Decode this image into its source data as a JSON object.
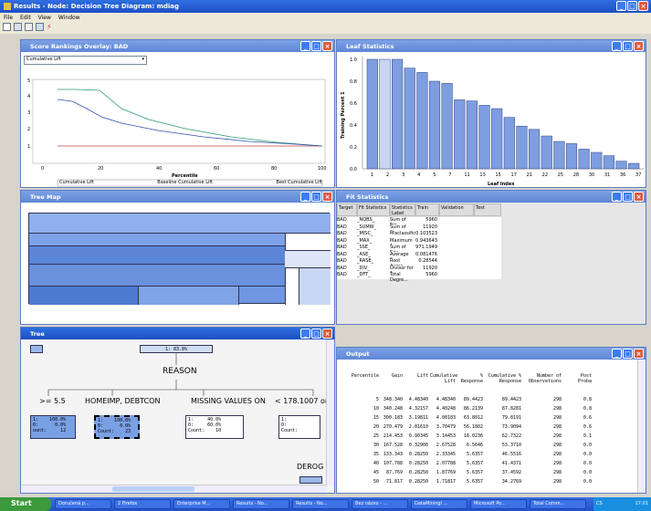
{
  "window": {
    "title": "Results - Node: Decision Tree Diagram: mdiag"
  },
  "menu": [
    "File",
    "Edit",
    "View",
    "Window"
  ],
  "score_panel": {
    "title": "Score Rankings Overlay: BAD",
    "dropdown": "Cumulative Lift",
    "xlabel": "Percentile",
    "legend": [
      "Cumulative Lift",
      "Baseline Cumulative Lift",
      "Best Cumulative Lift"
    ],
    "yticks": [
      "1",
      "2",
      "3",
      "4",
      "5"
    ],
    "xticks": [
      "0",
      "20",
      "40",
      "60",
      "80",
      "100"
    ]
  },
  "leaf_panel": {
    "title": "Leaf Statistics",
    "ylabel": "Training Percent 1",
    "xlabel": "Leaf Index",
    "yticks": [
      "0.0",
      "0.2",
      "0.4",
      "0.6",
      "0.8",
      "1.0"
    ],
    "xticks": [
      "1",
      "2",
      "3",
      "4",
      "5",
      "7",
      "11",
      "13",
      "15",
      "17",
      "21",
      "22",
      "25",
      "28",
      "30",
      "31",
      "36",
      "37"
    ]
  },
  "chart_data": {
    "type": "bar",
    "xlabel": "Leaf Index",
    "ylabel": "Training Percent 1",
    "ylim": [
      0,
      1
    ],
    "values": [
      1.0,
      1.0,
      1.0,
      0.92,
      0.88,
      0.8,
      0.78,
      0.63,
      0.62,
      0.58,
      0.55,
      0.47,
      0.39,
      0.36,
      0.3,
      0.25,
      0.23,
      0.18,
      0.15,
      0.12,
      0.07,
      0.05
    ]
  },
  "treemap_panel": {
    "title": "Tree Map"
  },
  "fit_panel": {
    "title": "Fit Statistics",
    "headers": [
      "Target",
      "Fit Statistics",
      "Statistics Label",
      "Train",
      "Validation",
      "Test"
    ],
    "rows": [
      [
        "BAD",
        "_NOBS_",
        "Sum of Fre...",
        "5960",
        "",
        ""
      ],
      [
        "BAD",
        "_SUMW_",
        "Sum of Cas...",
        "11920",
        "",
        ""
      ],
      [
        "BAD",
        "_MISC_",
        "Misclassific...",
        "0.103523",
        "",
        ""
      ],
      [
        "BAD",
        "_MAX_",
        "Maximum A...",
        "0.943643",
        "",
        ""
      ],
      [
        "BAD",
        "_SSE_",
        "Sum of Squ...",
        "971.1949",
        "",
        ""
      ],
      [
        "BAD",
        "_ASE_",
        "Average Sq...",
        "0.081476",
        "",
        ""
      ],
      [
        "BAD",
        "_RASE_",
        "Root Avera...",
        "0.28544",
        "",
        ""
      ],
      [
        "BAD",
        "_DIV_",
        "Divisor for A...",
        "11920",
        "",
        ""
      ],
      [
        "BAD",
        "_DFT_",
        "Total Degre...",
        "5960",
        "",
        ""
      ]
    ]
  },
  "tree_panel": {
    "title": "Tree",
    "root_label": "1: 83.8%",
    "split": "REASON",
    "branches": [
      ">= 5.5",
      "HOMEIMP, DEBTCON",
      "MISSING VALUES ON",
      "< 178.1007 or"
    ],
    "nodes": [
      {
        "l1": "1:    100.0%",
        "l2": "0:      0.0%",
        "l3": "ount:     12"
      },
      {
        "l1": "1:    100.0%",
        "l2": "0:      0.0%",
        "l3": "Count:    23"
      },
      {
        "l1": "1:     40.0%",
        "l2": "0:     60.0%",
        "l3": "Count:    10"
      },
      {
        "l1": "1:     ",
        "l2": "0:     ",
        "l3": "Count:     "
      }
    ],
    "deroc": "DEROG"
  },
  "output_panel": {
    "title": "Output",
    "headers": [
      "Percentile",
      "Gain",
      "Lift",
      "Cumulative Lift",
      "% Response",
      "Cumulative % Response",
      "Number of Observations",
      "Post Proba"
    ],
    "rows": [
      [
        "5",
        "348.340",
        "4.48340",
        "4.48340",
        "89.4423",
        "89.4423",
        "298",
        "0.8"
      ],
      [
        "10",
        "340.248",
        "4.32157",
        "4.40248",
        "86.2139",
        "87.8281",
        "298",
        "0.8"
      ],
      [
        "15",
        "300.183",
        "3.19811",
        "4.00183",
        "63.8012",
        "79.8191",
        "298",
        "0.6"
      ],
      [
        "20",
        "270.479",
        "2.81610",
        "3.70479",
        "56.1802",
        "73.9094",
        "298",
        "0.6"
      ],
      [
        "25",
        "214.453",
        "0.90345",
        "3.14453",
        "18.0236",
        "62.7322",
        "298",
        "0.1"
      ],
      [
        "30",
        "167.528",
        "0.32906",
        "2.67528",
        "6.5646",
        "53.3710",
        "298",
        "0.0"
      ],
      [
        "35",
        "133.343",
        "0.28250",
        "2.33345",
        "5.6357",
        "46.5516",
        "298",
        "0.0"
      ],
      [
        "40",
        "107.788",
        "0.28250",
        "2.07788",
        "5.6357",
        "41.4371",
        "298",
        "0.0"
      ],
      [
        "45",
        "87.769",
        "0.28250",
        "1.87769",
        "5.6357",
        "37.4592",
        "298",
        "0.0"
      ],
      [
        "50",
        "71.817",
        "0.28250",
        "1.71817",
        "5.6357",
        "34.2769",
        "298",
        "0.0"
      ]
    ]
  },
  "taskbar": {
    "start": "Start",
    "items": [
      "Doručená p...",
      "2 Firefox",
      "Enterprise M...",
      "Results - No...",
      "Results - No...",
      "Bez názvu - ...",
      "DataMiningI ...",
      "Microsoft Po...",
      "Total Comm..."
    ],
    "tray": "CS",
    "clock": "17:01"
  }
}
